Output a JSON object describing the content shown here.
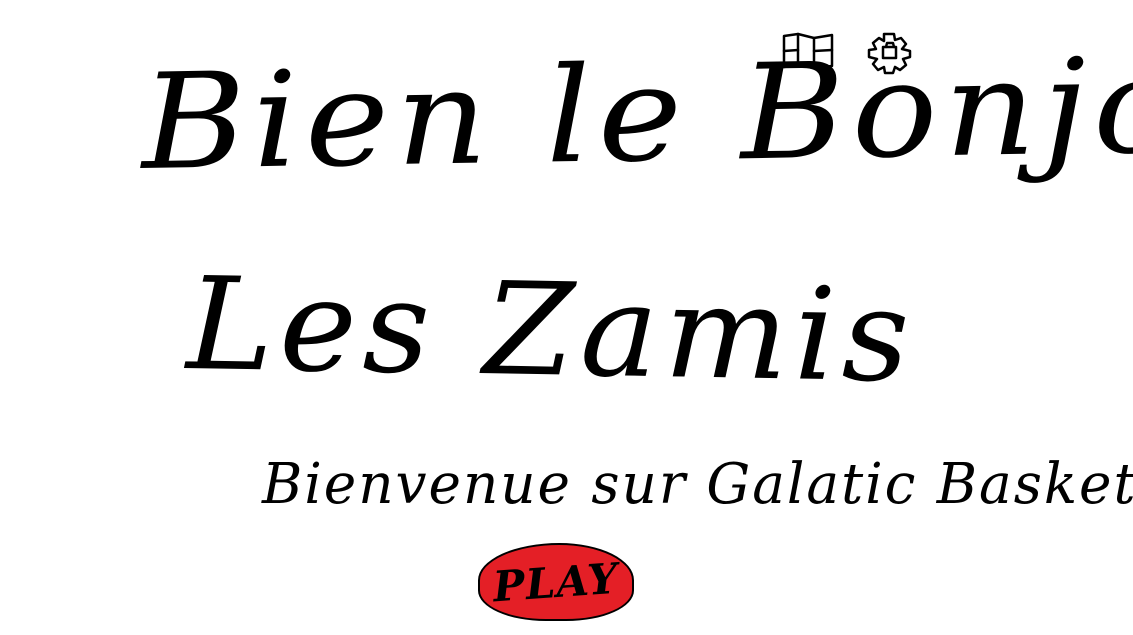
{
  "screen": {
    "title_line_1": "Bien le Bonjour",
    "title_line_2": "Les Zamis",
    "subtitle": "Bienvenue sur Galatic Basket"
  },
  "toolbar": {
    "map_icon": "map-icon",
    "settings_icon": "gear-icon"
  },
  "play_button": {
    "label": "PLAY",
    "color": "#e41f26"
  },
  "colors": {
    "background": "#ffffff",
    "ink": "#000000",
    "accent": "#e41f26"
  }
}
